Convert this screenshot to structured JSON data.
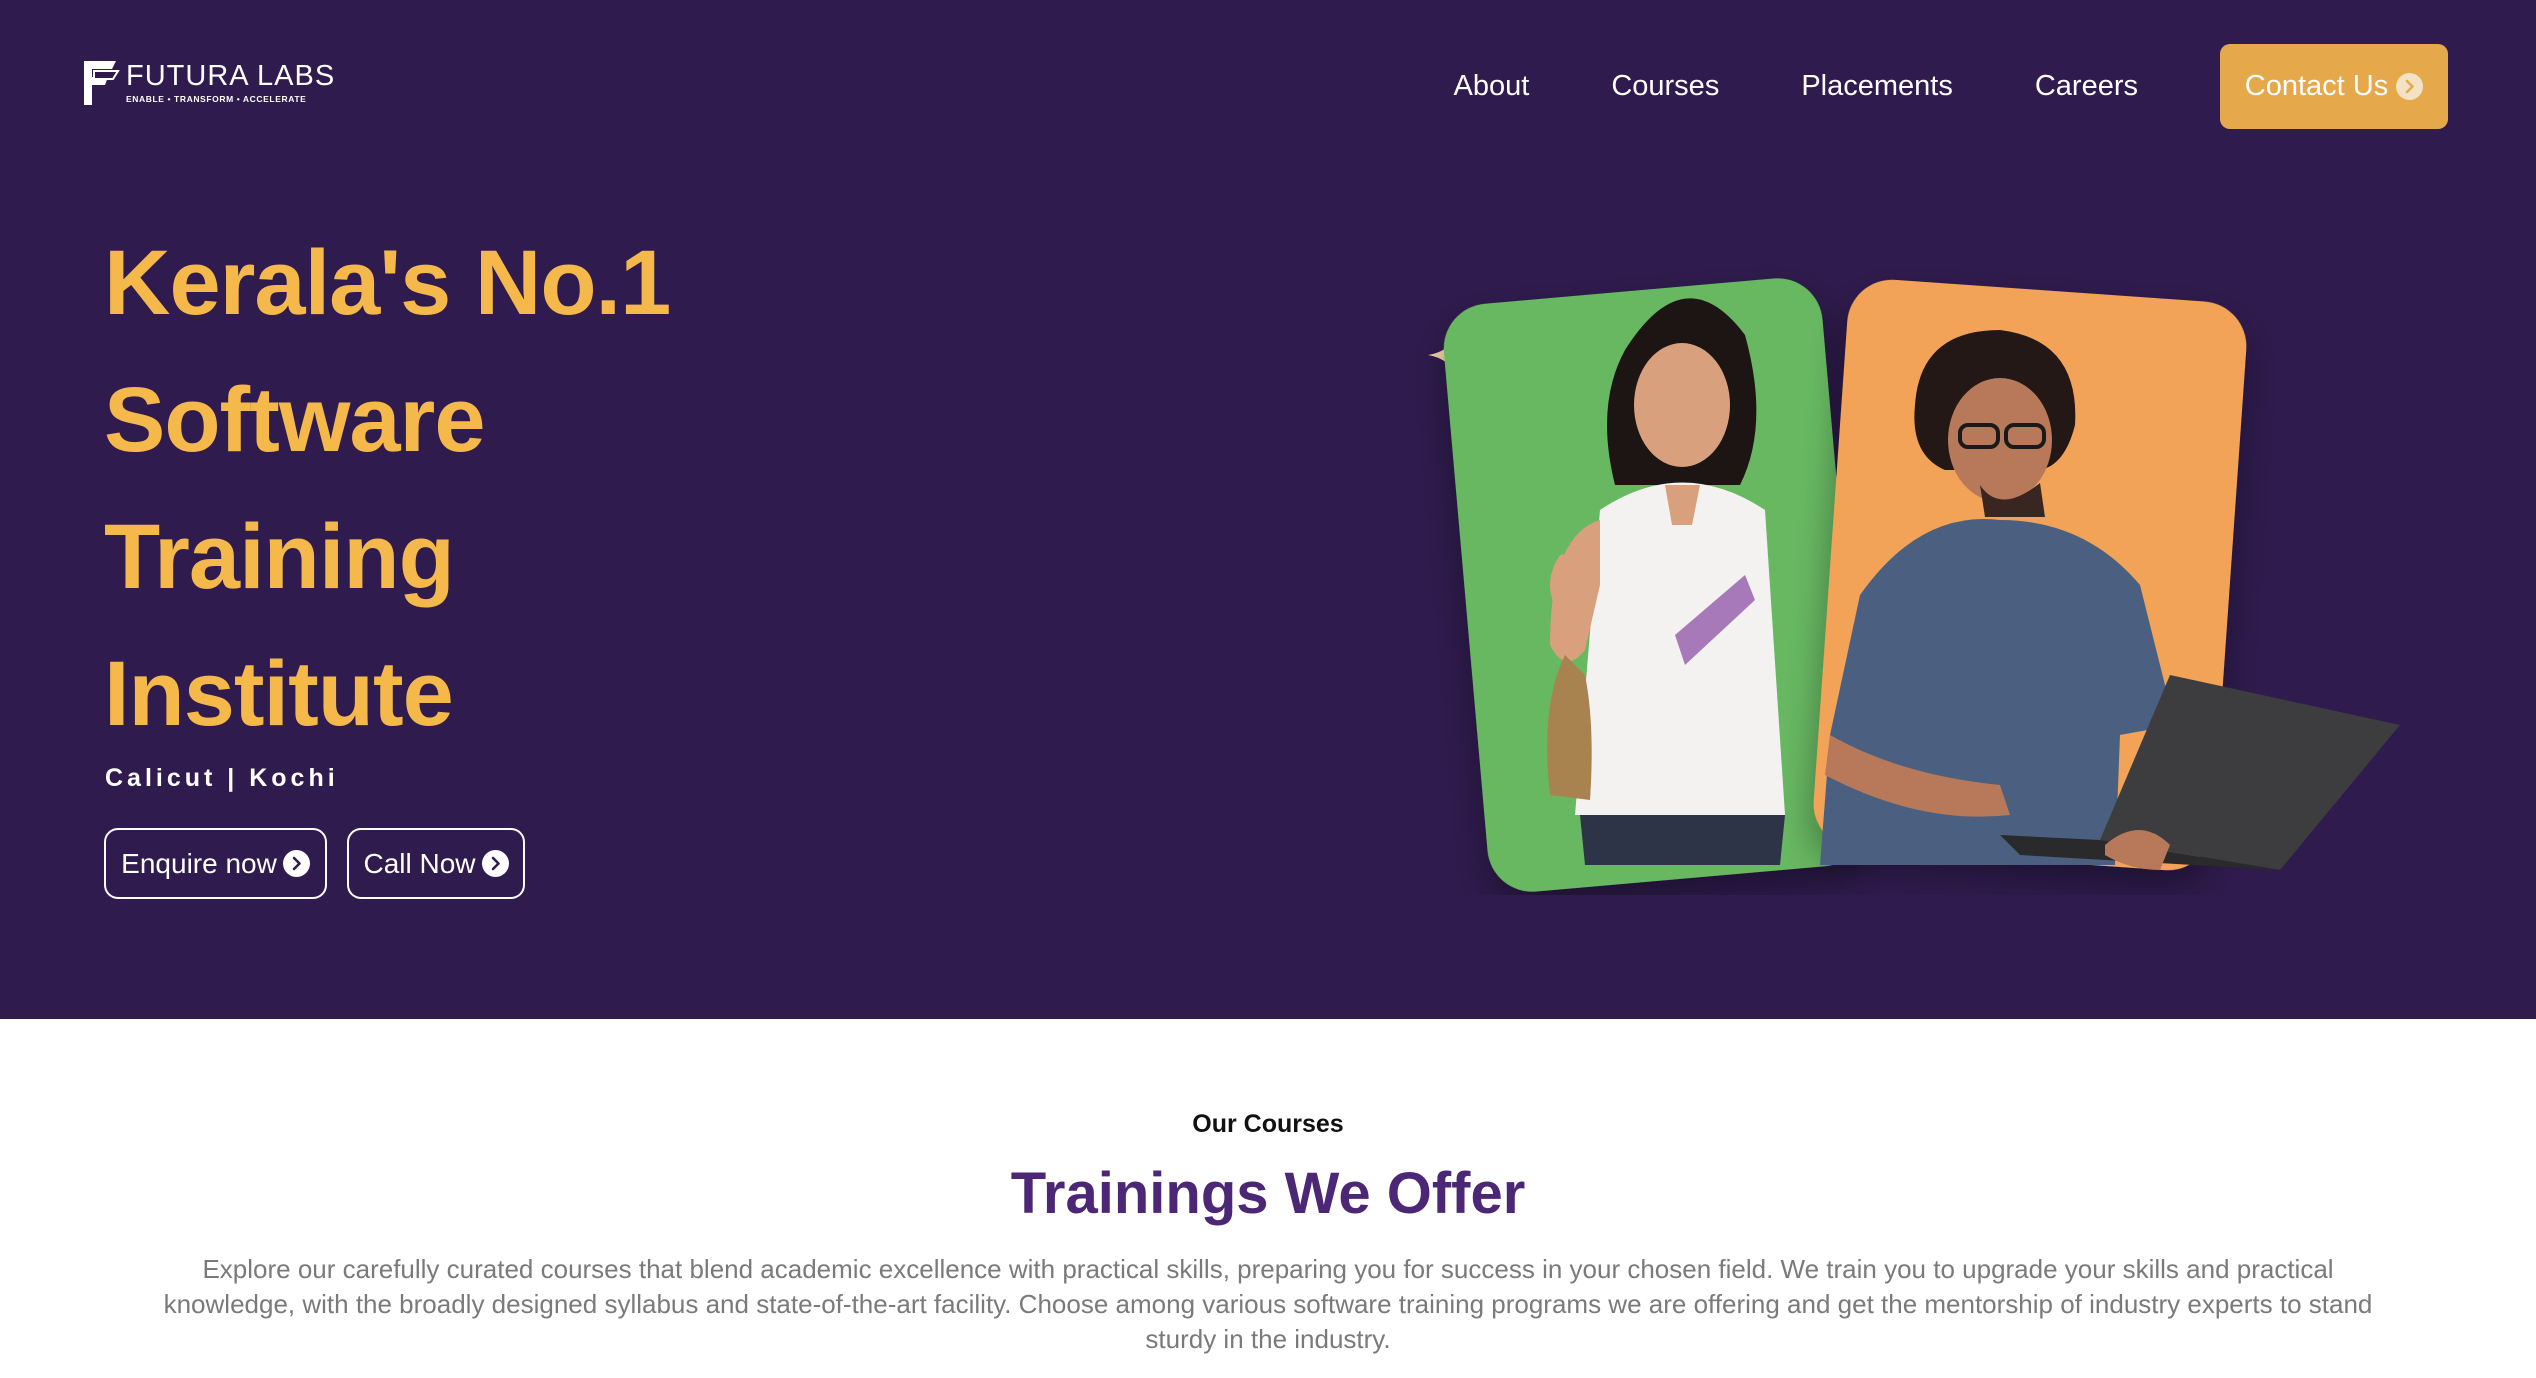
{
  "brand": {
    "name": "FUTURA LABS",
    "tagline": "ENABLE • TRANSFORM • ACCELERATE"
  },
  "nav": {
    "items": [
      {
        "label": "About"
      },
      {
        "label": "Courses"
      },
      {
        "label": "Placements"
      },
      {
        "label": "Careers"
      }
    ],
    "contact_label": "Contact Us"
  },
  "hero": {
    "headline_lines": [
      "Kerala's No.1",
      "Software",
      "Training",
      "Institute"
    ],
    "locations": "Calicut | Kochi",
    "enquire_label": "Enquire now",
    "call_label": "Call Now"
  },
  "courses": {
    "eyebrow": "Our Courses",
    "title": "Trainings We Offer",
    "description": "Explore our carefully curated courses that blend academic excellence with practical skills, preparing you for success in your chosen field. We train you to upgrade your skills and practical knowledge, with the broadly designed syllabus and state-of-the-art facility. Choose among various software training programs we are offering and get the mentorship of industry experts to stand sturdy in the industry."
  },
  "colors": {
    "hero_bg": "#2f1b4d",
    "accent_yellow": "#f5b84a",
    "button_gold": "#e5a94b",
    "card_green": "#67b862",
    "card_orange": "#f2a358",
    "title_purple": "#4b2775"
  }
}
